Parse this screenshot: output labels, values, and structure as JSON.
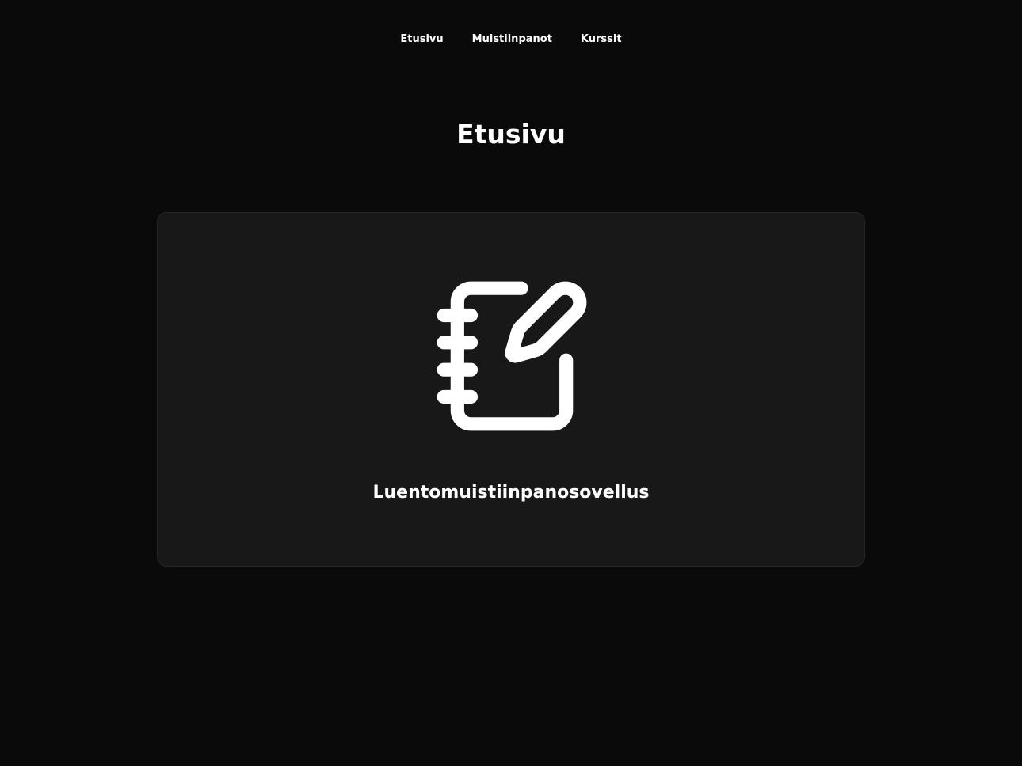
{
  "nav": {
    "items": [
      {
        "label": "Etusivu"
      },
      {
        "label": "Muistiinpanot"
      },
      {
        "label": "Kurssit"
      }
    ]
  },
  "page": {
    "title": "Etusivu"
  },
  "card": {
    "icon": "notebook-pen-icon",
    "title": "Luentomuistiinpanosovellus"
  },
  "colors": {
    "background": "#0a0a0a",
    "card_background": "#181818",
    "card_border": "#262626",
    "text": "#ffffff"
  }
}
